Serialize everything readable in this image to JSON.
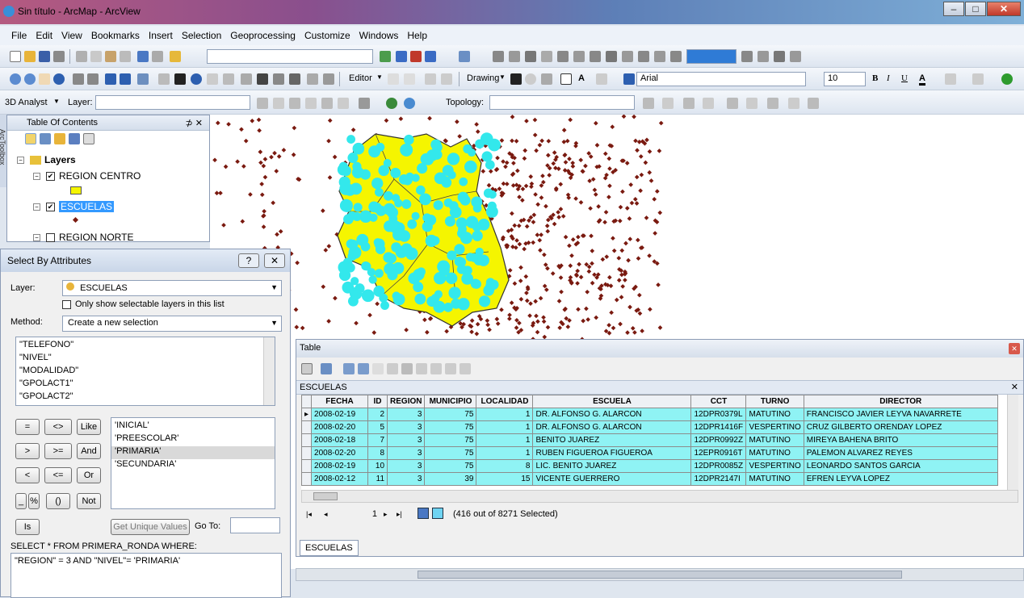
{
  "window": {
    "title": "Sin título - ArcMap - ArcView"
  },
  "menu": [
    "File",
    "Edit",
    "View",
    "Bookmarks",
    "Insert",
    "Selection",
    "Geoprocessing",
    "Customize",
    "Windows",
    "Help"
  ],
  "toolbar": {
    "editor": "Editor",
    "drawing": "Drawing",
    "font": "Arial",
    "font_size": "10",
    "bold": "B",
    "italic": "I",
    "underline": "U",
    "analyst3d": "3D Analyst",
    "layer_label": "Layer:",
    "topology": "Topology:"
  },
  "toc": {
    "title": "Table Of Contents",
    "arctoolbox": "ArcToolbox",
    "root": "Layers",
    "layers": [
      {
        "name": "REGION CENTRO",
        "checked": true
      },
      {
        "name": "ESCUELAS",
        "checked": true,
        "selected": true
      },
      {
        "name": "REGION NORTE",
        "checked": false
      }
    ]
  },
  "select_by_attributes": {
    "title": "Select By Attributes",
    "layer_label": "Layer:",
    "layer_value": "ESCUELAS",
    "only_selectable": "Only show selectable layers in this list",
    "method_label": "Method:",
    "method_value": "Create a new selection",
    "fields": [
      "\"TELEFONO\"",
      "\"NIVEL\"",
      "\"MODALIDAD\"",
      "\"GPOLACT1\"",
      "\"GPOLACT2\""
    ],
    "operators": [
      "=",
      "<>",
      "Like",
      ">",
      ">=",
      "And",
      "<",
      "<=",
      "Or",
      "_",
      "%",
      "()",
      "Not",
      "Is"
    ],
    "values": [
      "'INICIAL'",
      "'PREESCOLAR'",
      "'PRIMARIA'",
      "'SECUNDARIA'"
    ],
    "get_unique": "Get Unique Values",
    "go_to": "Go To:",
    "sql_prefix": "SELECT * FROM PRIMERA_RONDA WHERE:",
    "sql_expression": "\"REGION\" = 3 AND \"NIVEL\"= 'PRIMARIA'"
  },
  "table": {
    "title": "Table",
    "layer_name": "ESCUELAS",
    "tab": "ESCUELAS",
    "record": "1",
    "status": "(416 out of 8271 Selected)",
    "columns": [
      "FECHA",
      "ID",
      "REGION",
      "MUNICIPIO",
      "LOCALIDAD",
      "ESCUELA",
      "CCT",
      "TURNO",
      "DIRECTOR"
    ],
    "rows": [
      [
        "2008-02-19",
        "2",
        "3",
        "75",
        "1",
        "DR. ALFONSO G. ALARCON",
        "12DPR0379L",
        "MATUTINO",
        "FRANCISCO JAVIER LEYVA NAVARRETE"
      ],
      [
        "2008-02-20",
        "5",
        "3",
        "75",
        "1",
        "DR. ALFONSO G. ALARCON",
        "12DPR1416F",
        "VESPERTINO",
        "CRUZ GILBERTO ORENDAY LOPEZ"
      ],
      [
        "2008-02-18",
        "7",
        "3",
        "75",
        "1",
        "BENITO JUAREZ",
        "12DPR0992Z",
        "MATUTINO",
        "MIREYA BAHENA BRITO"
      ],
      [
        "2008-02-20",
        "8",
        "3",
        "75",
        "1",
        "RUBEN FIGUEROA FIGUEROA",
        "12EPR0916T",
        "MATUTINO",
        "PALEMON ALVAREZ REYES"
      ],
      [
        "2008-02-19",
        "10",
        "3",
        "75",
        "8",
        "LIC. BENITO JUAREZ",
        "12DPR0085Z",
        "VESPERTINO",
        "LEONARDO SANTOS GARCIA"
      ],
      [
        "2008-02-12",
        "11",
        "3",
        "39",
        "15",
        "VICENTE GUERRERO",
        "12DPR2147I",
        "MATUTINO",
        "EFREN LEYVA LOPEZ"
      ]
    ]
  },
  "colors": {
    "selection": "#33e8ec",
    "region_fill": "#f5f500",
    "points": "#7a1a10"
  }
}
